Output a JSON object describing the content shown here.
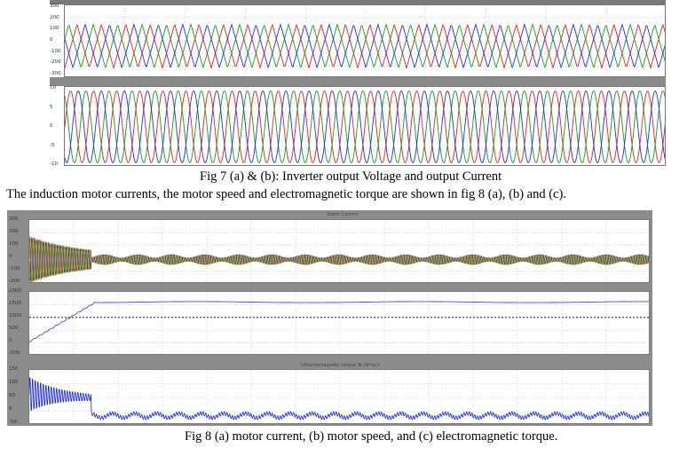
{
  "figure7": {
    "caption": "Fig 7 (a) & (b): Inverter output Voltage and output Current",
    "panel_a": {
      "name": "inverter-output-voltage",
      "ticks": [
        "300",
        "200",
        "100",
        "0",
        "-100",
        "-200",
        "-300"
      ]
    },
    "panel_b": {
      "name": "inverter-output-current",
      "ticks": [
        "10",
        "5",
        "0",
        "-5",
        "-10"
      ]
    }
  },
  "body_text": "The induction motor currents, the motor speed and electromagnetic torque are shown in fig 8 (a), (b) and (c).",
  "figure8": {
    "caption": "Fig 8 (a) motor current, (b) motor speed, and (c) electromagnetic torque.",
    "panel_a": {
      "title": "Stator Current",
      "ticks": [
        "300",
        "200",
        "100",
        "0",
        "-100",
        "-200"
      ]
    },
    "panel_b": {
      "title": "",
      "ticks": [
        "2000",
        "1500",
        "1000",
        "500",
        "0",
        "-500"
      ]
    },
    "panel_c": {
      "title": "<Electromagnetic torque Te (N*m)>",
      "ticks": [
        "150",
        "100",
        "50",
        "0",
        "-50"
      ]
    }
  },
  "colors": {
    "phase_a": "#e02020",
    "phase_b": "#1a9a1a",
    "phase_c": "#2030e0",
    "speed": "#3a4fd8",
    "torque": "#1424e0",
    "frame": "#8a8a8a"
  },
  "chart_data": [
    {
      "type": "line",
      "title": "",
      "xlabel": "",
      "ylabel": "",
      "series": [
        {
          "values": [
            0,
            220,
            220,
            -220,
            -220,
            0
          ]
        },
        {
          "values": [
            -220,
            -220,
            0,
            220,
            220,
            -220
          ]
        },
        {
          "values": [
            220,
            0,
            -220,
            0,
            220,
            220
          ]
        }
      ],
      "ylim": [
        -300,
        300
      ]
    },
    {
      "type": "line",
      "title": "",
      "xlabel": "",
      "ylabel": "",
      "series": [
        {
          "values": [
            0,
            8,
            0,
            -8,
            0
          ]
        },
        {
          "values": [
            -7,
            4,
            7,
            -4,
            -7
          ]
        },
        {
          "values": [
            7,
            -4,
            -7,
            4,
            7
          ]
        }
      ],
      "ylim": [
        -10,
        10
      ]
    },
    {
      "type": "line",
      "title": "Stator Current",
      "xlabel": "",
      "ylabel": "",
      "series": [
        {
          "values": [
            150,
            120,
            90,
            60,
            20,
            10,
            10,
            10,
            10,
            10
          ]
        },
        {
          "values": [
            -150,
            -120,
            -90,
            -60,
            -20,
            -10,
            -10,
            -10,
            -10,
            -10
          ]
        }
      ],
      "ylim": [
        -200,
        300
      ]
    },
    {
      "type": "line",
      "title": "",
      "xlabel": "",
      "ylabel": "",
      "series": [
        {
          "values": [
            0,
            400,
            900,
            1450,
            1480,
            1480,
            1480,
            1480,
            1480,
            1480
          ]
        }
      ],
      "ylim": [
        -500,
        2000
      ]
    },
    {
      "type": "line",
      "title": "<Electromagnetic torque Te (N*m)>",
      "xlabel": "",
      "ylabel": "",
      "series": [
        {
          "values": [
            80,
            60,
            40,
            30,
            8,
            8,
            8,
            8,
            8,
            8
          ]
        }
      ],
      "ylim": [
        -50,
        150
      ]
    }
  ]
}
